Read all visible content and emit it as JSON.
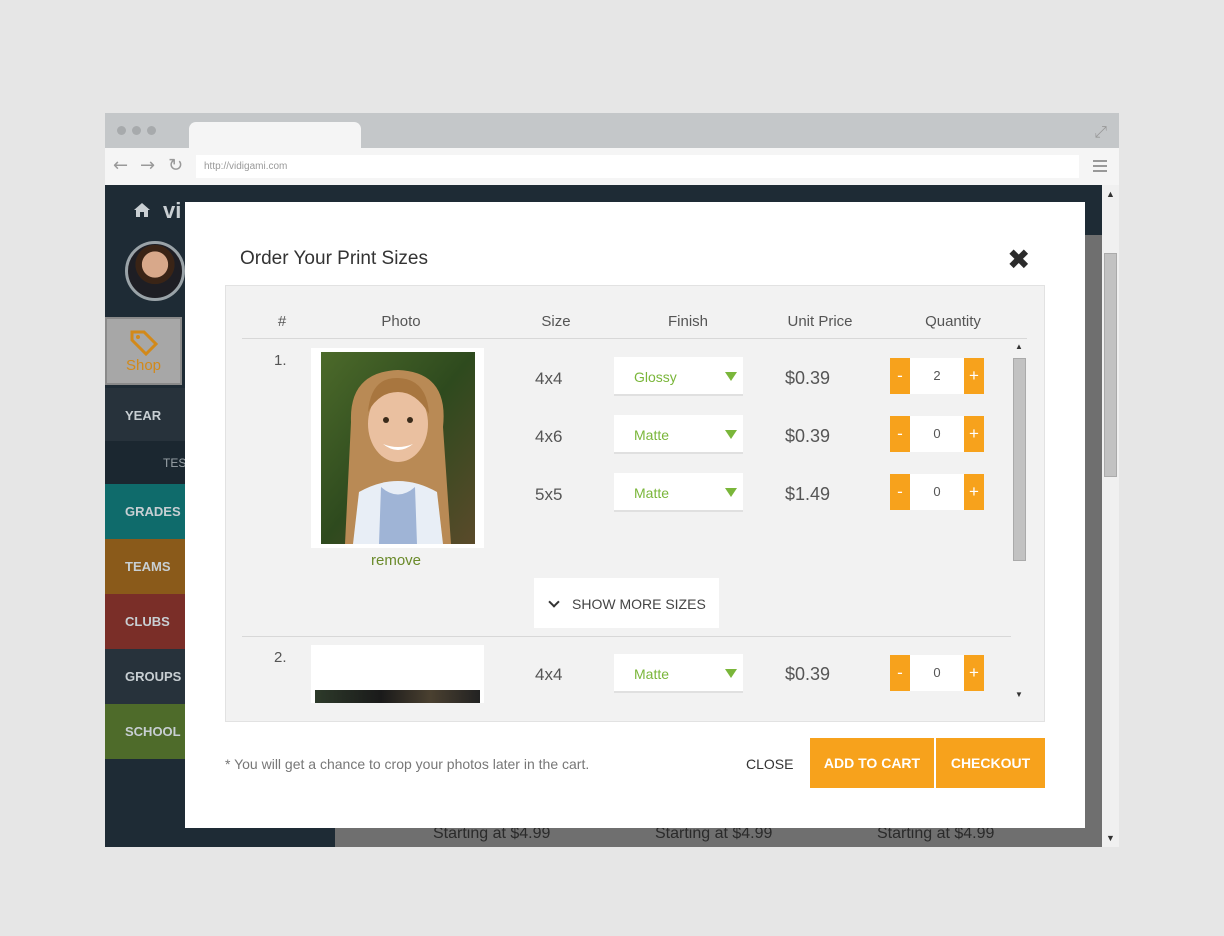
{
  "browser": {
    "url": "http://vidigami.com"
  },
  "site": {
    "logo_fragment": "vi",
    "sidebar": {
      "shop_label": "Shop",
      "year_label": "YEAR",
      "year_sub": "TES",
      "items": [
        {
          "label": "GRADES",
          "color": "#0f6b6b"
        },
        {
          "label": "TEAMS",
          "color": "#8a5a1a"
        },
        {
          "label": "CLUBS",
          "color": "#7a2e28"
        },
        {
          "label": "GROUPS",
          "color": "#27323b"
        },
        {
          "label": "SCHOOL",
          "color": "#4e6b2a"
        }
      ]
    },
    "prices_below": [
      "Starting at $4.99",
      "Starting at $4.99",
      "Starting at $4.99"
    ]
  },
  "modal": {
    "title": "Order Your Print Sizes",
    "columns": [
      "#",
      "Photo",
      "Size",
      "Finish",
      "Unit Price",
      "Quantity"
    ],
    "remove_label": "remove",
    "show_more_label": "SHOW MORE SIZES",
    "qty_minus": "-",
    "qty_plus": "+",
    "photo1_rows": [
      {
        "size": "4x4",
        "finish": "Glossy",
        "price": "$0.39",
        "qty": "2"
      },
      {
        "size": "4x6",
        "finish": "Matte",
        "price": "$0.39",
        "qty": "0"
      },
      {
        "size": "5x5",
        "finish": "Matte",
        "price": "$1.49",
        "qty": "0"
      }
    ],
    "photo2_rows": [
      {
        "size": "4x4",
        "finish": "Matte",
        "price": "$0.39",
        "qty": "0"
      }
    ],
    "index1": "1.",
    "index2": "2.",
    "footnote": "* You will get a chance to crop your photos later in the cart.",
    "close_label": "CLOSE",
    "add_to_cart_label": "ADD TO CART",
    "checkout_label": "CHECKOUT",
    "accent": "#f7a21c",
    "finish_color": "#7ab63a"
  }
}
